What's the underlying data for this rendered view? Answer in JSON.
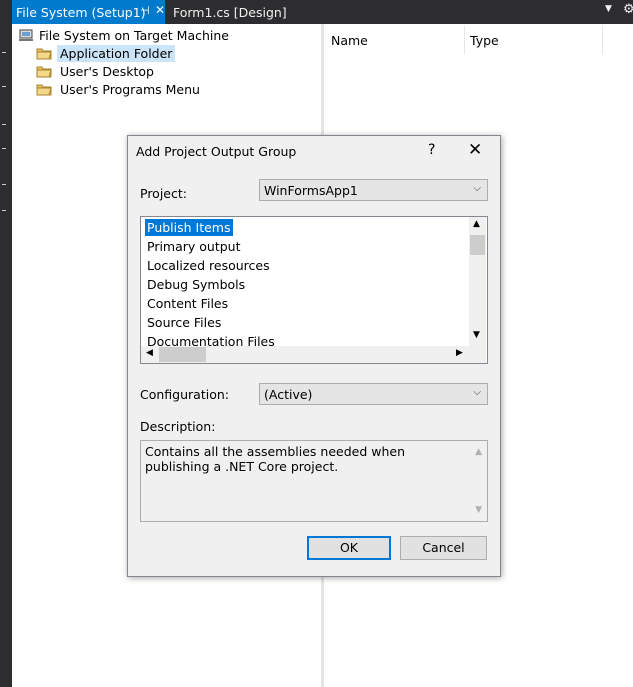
{
  "tabs": {
    "active_label": "File System (Setup1)",
    "pin_glyph": "⊣",
    "close_glyph": "✕",
    "second_label": "Form1.cs [Design]"
  },
  "tree": {
    "root_label": "File System on Target Machine",
    "items": [
      {
        "label": "Application Folder",
        "selected": true
      },
      {
        "label": "User's Desktop",
        "selected": false
      },
      {
        "label": "User's Programs Menu",
        "selected": false
      }
    ]
  },
  "list": {
    "columns": [
      "Name",
      "Type"
    ]
  },
  "dialog": {
    "title": "Add Project Output Group",
    "help_glyph": "?",
    "close_glyph": "✕",
    "project_label": "Project:",
    "project_value": "WinFormsApp1",
    "outputs": [
      "Publish Items",
      "Primary output",
      "Localized resources",
      "Debug Symbols",
      "Content Files",
      "Source Files",
      "Documentation Files"
    ],
    "selected_output_index": 0,
    "configuration_label": "Configuration:",
    "configuration_value": "(Active)",
    "description_label": "Description:",
    "description_text": "Contains all the assemblies needed when publishing a .NET Core project.",
    "ok_label": "OK",
    "cancel_label": "Cancel"
  },
  "colors": {
    "accent": "#0078d7",
    "tab_active": "#007acc",
    "chrome_dark": "#2d2d30",
    "tree_selection": "#cce4f7"
  }
}
